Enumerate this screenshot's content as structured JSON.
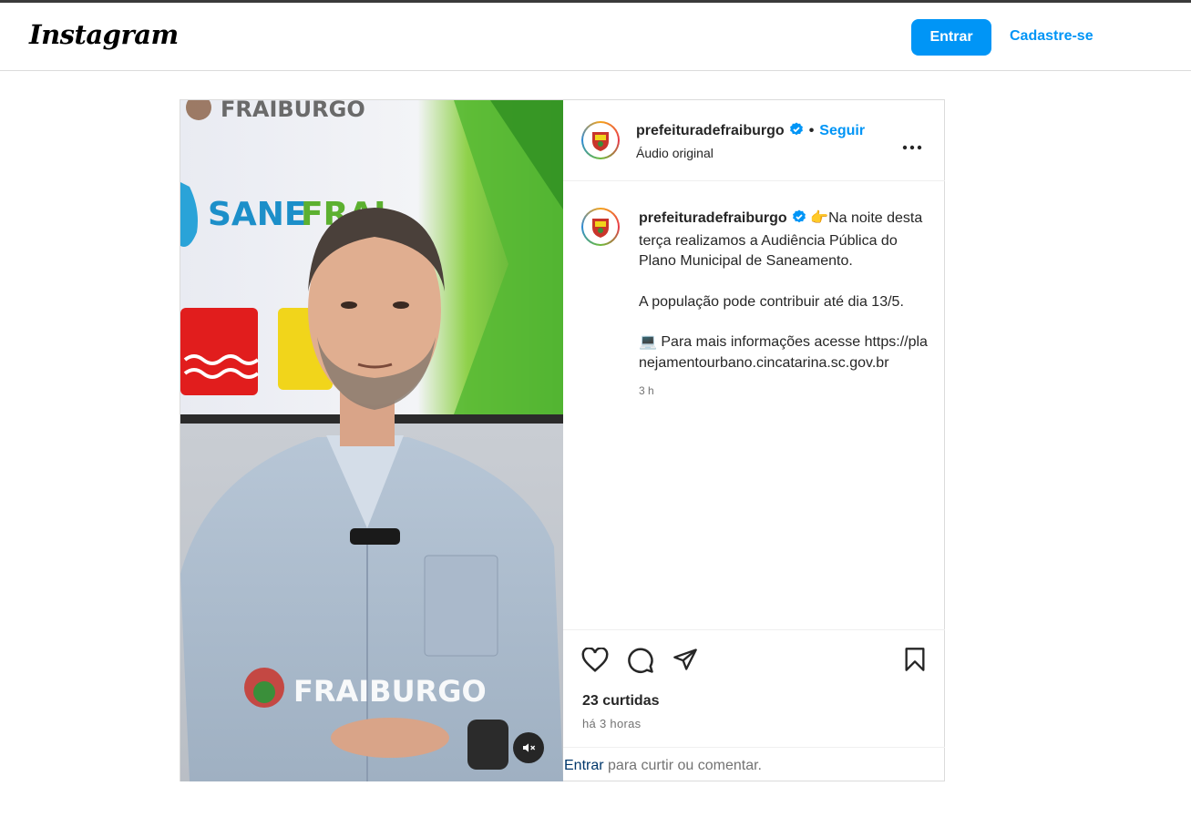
{
  "header": {
    "logo": "Instagram",
    "login_label": "Entrar",
    "signup_label": "Cadastre-se"
  },
  "post": {
    "username": "prefeituradefraiburgo",
    "follow_label": "Seguir",
    "separator": "•",
    "audio_label": "Áudio original",
    "more_icon": "more-horizontal-icon",
    "media": {
      "overlay_top_text": "FRAIBURGO",
      "screen_brand_text": "SANEFRAI",
      "bottom_brand_text": "FRAIBURGO",
      "mute_icon": "speaker-muted-icon"
    },
    "caption": {
      "username": "prefeituradefraiburgo",
      "line1_emoji": "👉",
      "paragraph1": "Na noite desta terça realizamos a Audiência Pública do Plano Municipal de Saneamento.",
      "paragraph2": "A população pode contribuir até dia 13/5.",
      "paragraph3_emoji": "💻",
      "paragraph3": "Para mais informações acesse https://planejamentourbano.cincatarina.sc.gov.br",
      "time": "3 h"
    },
    "likes": "23 curtidas",
    "posted_ago": "há 3 horas",
    "login_prompt": {
      "link": "Entrar",
      "text": "para curtir ou comentar."
    }
  },
  "colors": {
    "accent": "#0095f6",
    "border": "#dbdbdb",
    "text": "#262626",
    "muted": "#737373",
    "verified": "#0095f6"
  }
}
